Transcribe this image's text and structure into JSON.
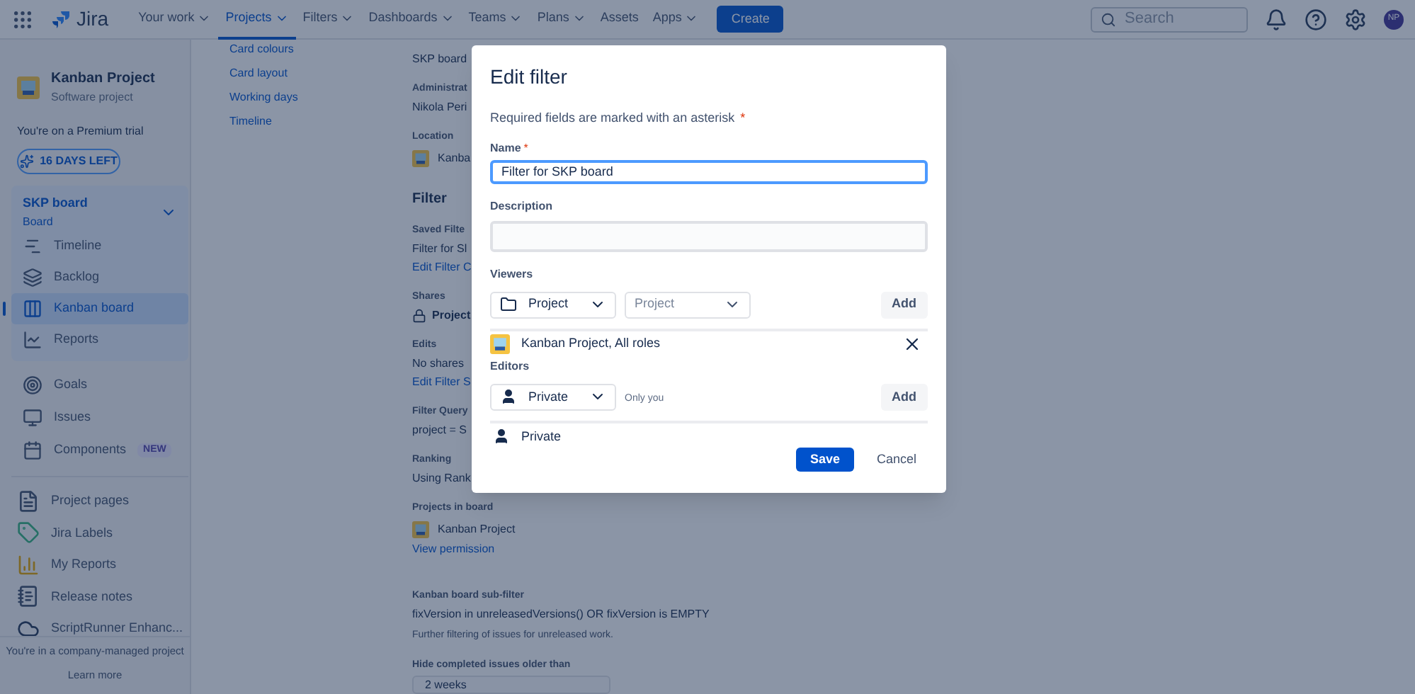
{
  "nav": {
    "logo": "Jira",
    "items": [
      {
        "label": "Your work",
        "dropdown": true,
        "selected": false
      },
      {
        "label": "Projects",
        "dropdown": true,
        "selected": true
      },
      {
        "label": "Filters",
        "dropdown": true,
        "selected": false
      },
      {
        "label": "Dashboards",
        "dropdown": true,
        "selected": false
      },
      {
        "label": "Teams",
        "dropdown": true,
        "selected": false
      },
      {
        "label": "Plans",
        "dropdown": true,
        "selected": false
      },
      {
        "label": "Assets",
        "dropdown": false,
        "selected": false
      },
      {
        "label": "Apps",
        "dropdown": true,
        "selected": false
      }
    ],
    "create": "Create",
    "search": {
      "placeholder": "Search"
    },
    "avatar": "NP"
  },
  "sidebar": {
    "project": {
      "name": "Kanban Project",
      "type": "Software project"
    },
    "trial": "You're on a Premium trial",
    "trial_button": "16 DAYS LEFT",
    "board": {
      "name": "SKP board",
      "type": "Board",
      "expanded": true,
      "items": [
        {
          "label": "Timeline",
          "kind": "timeline",
          "selected": false
        },
        {
          "label": "Backlog",
          "kind": "backlog",
          "selected": false
        },
        {
          "label": "Kanban board",
          "kind": "board",
          "selected": true
        },
        {
          "label": "Reports",
          "kind": "reports",
          "selected": false
        }
      ]
    },
    "items": [
      {
        "label": "Goals",
        "kind": "goals"
      },
      {
        "label": "Issues",
        "kind": "issues"
      },
      {
        "label": "Components",
        "kind": "components",
        "badge": "NEW"
      }
    ],
    "apps": [
      {
        "label": "Project pages",
        "kind": "pages"
      },
      {
        "label": "Jira Labels",
        "kind": "labels"
      },
      {
        "label": "My Reports",
        "kind": "myreports"
      },
      {
        "label": "Release notes",
        "kind": "release"
      },
      {
        "label": "ScriptRunner Enhanc...",
        "kind": "scriptrunner"
      }
    ],
    "footer": {
      "text": "You're in a company-managed project",
      "link": "Learn more"
    }
  },
  "settings_links": [
    "Card colours",
    "Card layout",
    "Working days",
    "Timeline"
  ],
  "details": [
    {
      "kind": "text",
      "text": "SKP board"
    },
    {
      "kind": "label",
      "text": "Administrat"
    },
    {
      "kind": "text",
      "text": "Nikola Peri"
    },
    {
      "kind": "label",
      "text": "Location"
    },
    {
      "kind": "project",
      "text": "Kanba"
    },
    {
      "kind": "heading",
      "text": "Filter"
    },
    {
      "kind": "label",
      "text": "Saved Filte"
    },
    {
      "kind": "text",
      "text": "Filter for Sl"
    },
    {
      "kind": "link",
      "text": "Edit Filter C"
    },
    {
      "kind": "label",
      "text": "Shares"
    },
    {
      "kind": "lock",
      "text": "Project"
    },
    {
      "kind": "label",
      "text": "Edits"
    },
    {
      "kind": "text",
      "text": "No shares"
    },
    {
      "kind": "link",
      "text": "Edit Filter S"
    },
    {
      "kind": "label",
      "text": "Filter Query"
    },
    {
      "kind": "text",
      "text": "project = S"
    },
    {
      "kind": "label",
      "text": "Ranking"
    },
    {
      "kind": "text",
      "text": "Using Rank"
    },
    {
      "kind": "label",
      "text": "Projects in board"
    },
    {
      "kind": "project",
      "text": "Kanban Project"
    },
    {
      "kind": "link",
      "text": "View permission"
    },
    {
      "kind": "gap"
    },
    {
      "kind": "label",
      "text": "Kanban board sub-filter"
    },
    {
      "kind": "text",
      "text": "fixVersion in unreleasedVersions() OR fixVersion is EMPTY"
    },
    {
      "kind": "hint",
      "text": "Further filtering of issues for unreleased work."
    },
    {
      "kind": "label",
      "text": "Hide completed issues older than"
    },
    {
      "kind": "select",
      "text": "2 weeks"
    }
  ],
  "modal": {
    "title": "Edit filter",
    "required_note": "Required fields are marked with an asterisk",
    "required_asterisk": "*",
    "name": {
      "label": "Name",
      "required_mark": "*",
      "value": "Filter for SKP board"
    },
    "description": {
      "label": "Description"
    },
    "viewers": {
      "label": "Viewers",
      "type_select": "Project",
      "target_placeholder": "Project",
      "add": "Add",
      "entries": [
        {
          "label": "Kanban Project, All roles"
        }
      ]
    },
    "editors": {
      "label": "Editors",
      "type_select": "Private",
      "hint": "Only you",
      "add": "Add",
      "entries": [
        {
          "label": "Private"
        }
      ]
    },
    "save": "Save",
    "cancel": "Cancel"
  }
}
